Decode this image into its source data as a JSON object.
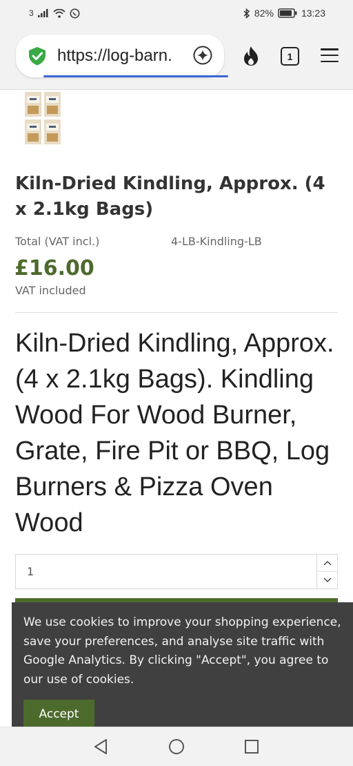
{
  "status_bar": {
    "carrier": "3",
    "battery": "82%",
    "time": "13:23"
  },
  "browser": {
    "url": "https://log-barn.",
    "tab_count": "1",
    "icons": [
      "shield-check-icon",
      "sparkle-icon",
      "fire-icon",
      "tabs-icon",
      "menu-icon"
    ]
  },
  "product": {
    "title": "Kiln-Dried Kindling, Approx. (4 x 2.1kg Bags)",
    "price_label": "Total (VAT incl.)",
    "sku": "4-LB-Kindling-LB",
    "price": "£16.00",
    "vat_note": "VAT included",
    "long_title": "Kiln-Dried Kindling, Approx. (4 x 2.1kg Bags). Kindling Wood For Wood Burner, Grate, Fire Pit or BBQ, Log Burners & Pizza Oven Wood",
    "quantity": "1"
  },
  "cookie_banner": {
    "text": "We use cookies to improve your shopping experience, save your preferences, and analyse site traffic with Google Analytics. By clicking \"Accept\", you agree to our use of cookies.",
    "accept_label": "Accept"
  },
  "colors": {
    "brand_green": "#4d6a2d",
    "banner_bg": "#404040",
    "progress_blue": "#3b66d6"
  }
}
